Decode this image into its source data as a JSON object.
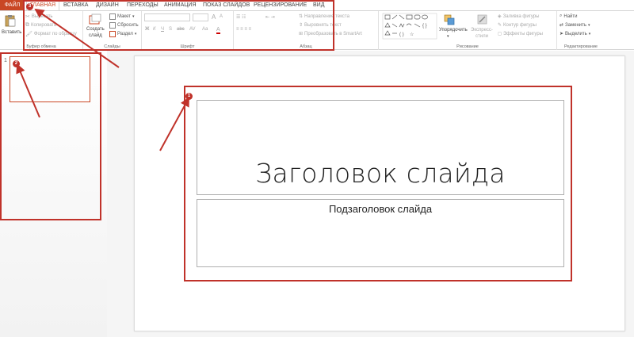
{
  "tabs": {
    "file": "ФАЙЛ",
    "items": [
      "ГЛАВНАЯ",
      "ВСТАВКА",
      "ДИЗАЙН",
      "ПЕРЕХОДЫ",
      "АНИМАЦИЯ",
      "ПОКАЗ СЛАЙДОВ",
      "РЕЦЕНЗИРОВАНИЕ",
      "ВИД"
    ]
  },
  "ribbon": {
    "clipboard": {
      "paste": "Вставить",
      "cut": "Вырезать",
      "copy": "Копировать",
      "format_painter": "Формат по образцу",
      "label": "Буфер обмена"
    },
    "slides": {
      "new_slide_line1": "Создать",
      "new_slide_line2": "слайд",
      "layout": "Макет",
      "reset": "Сбросить",
      "section": "Раздел",
      "label": "Слайды"
    },
    "font": {
      "label": "Шрифт",
      "bold": "Ж",
      "italic": "К",
      "underline": "Ч",
      "strike": "S",
      "shadow": "abc",
      "spacing": "AV",
      "case": "Aa",
      "grow": "A",
      "shrink": "A"
    },
    "paragraph": {
      "text_direction": "Направление текста",
      "align_text": "Выровнять текст",
      "smartart": "Преобразовать в SmartArt",
      "label": "Абзац"
    },
    "drawing": {
      "arrange_line1": "Упорядочить",
      "quick_styles_line1": "Экспресс-",
      "quick_styles_line2": "стили",
      "fill": "Заливка фигуры",
      "outline": "Контур фигуры",
      "effects": "Эффекты фигуры",
      "label": "Рисование"
    },
    "editing": {
      "find": "Найти",
      "replace": "Заменить",
      "select": "Выделить",
      "label": "Редактирование"
    }
  },
  "thumbnails": {
    "slide_number": "1"
  },
  "slide": {
    "title": "Заголовок слайда",
    "subtitle": "Подзаголовок слайда"
  },
  "annotations": {
    "badge_ribbon": "3",
    "badge_thumbs": "2",
    "badge_slide": "1",
    "color": "#c0322a"
  },
  "colors": {
    "accent": "#c94724"
  }
}
